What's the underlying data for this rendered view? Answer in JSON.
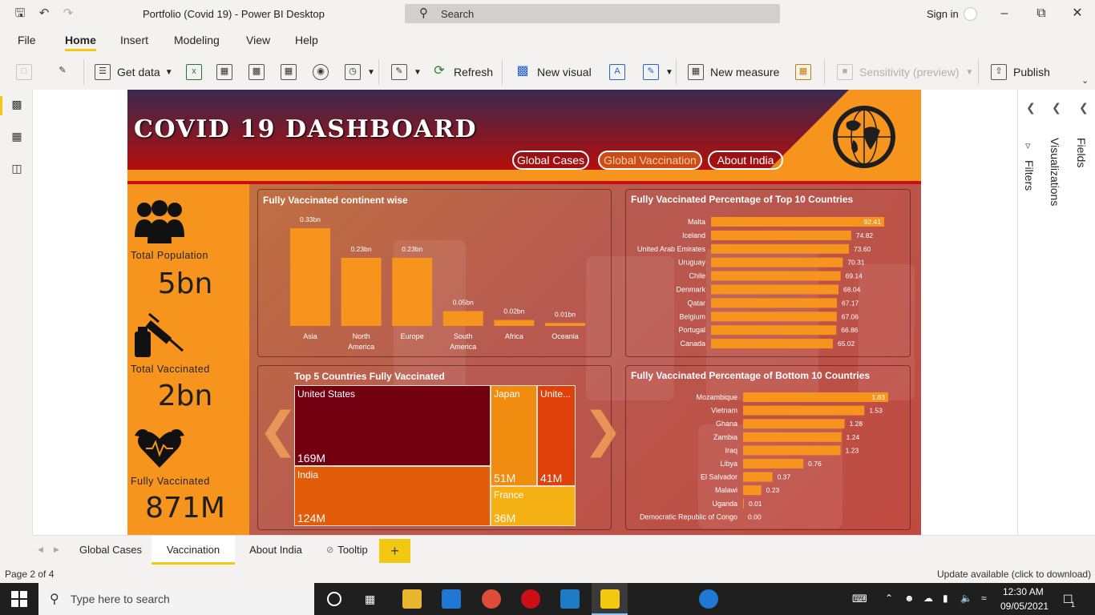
{
  "window": {
    "title": "Portfolio (Covid 19) - Power BI Desktop",
    "search_placeholder": "Search",
    "sign_in": "Sign in"
  },
  "menu": [
    "File",
    "Home",
    "Insert",
    "Modeling",
    "View",
    "Help"
  ],
  "ribbon": {
    "get_data": "Get data",
    "refresh": "Refresh",
    "new_visual": "New visual",
    "new_measure": "New measure",
    "sensitivity": "Sensitivity (preview)",
    "publish": "Publish"
  },
  "right_pane": {
    "filters": "Filters",
    "visualizations": "Visualizations",
    "fields": "Fields"
  },
  "report": {
    "title": "COVID 19 DASHBOARD",
    "nav": [
      "Global Cases",
      "Global Vaccination",
      "About India"
    ],
    "kpis": [
      {
        "label": "Total Population",
        "value": "5bn",
        "icon": "people-icon"
      },
      {
        "label": "Total Vaccinated",
        "value": "2bn",
        "icon": "syringe-icon"
      },
      {
        "label": "Fully Vaccinated",
        "value": "871M",
        "icon": "heart-muscle-icon"
      }
    ],
    "colors": {
      "accent": "#f6941e",
      "header_red": "#c81010",
      "treemap_dark": "#720010"
    }
  },
  "chart_data": [
    {
      "type": "bar",
      "title": "Fully Vaccinated continent wise",
      "categories": [
        "Asia",
        "North America",
        "Europe",
        "South America",
        "Africa",
        "Oceania"
      ],
      "category_lines": [
        [
          "Asia"
        ],
        [
          "North",
          "America"
        ],
        [
          "Europe"
        ],
        [
          "South",
          "America"
        ],
        [
          "Africa"
        ],
        [
          "Oceania"
        ]
      ],
      "values": [
        0.33,
        0.23,
        0.23,
        0.05,
        0.02,
        0.01
      ],
      "data_labels": [
        "0.33bn",
        "0.23bn",
        "0.23bn",
        "0.05bn",
        "0.02bn",
        "0.01bn"
      ],
      "ylim": [
        0,
        0.33
      ]
    },
    {
      "type": "bar",
      "orientation": "horizontal",
      "title": "Fully Vaccinated Percentage of Top 10 Countries",
      "categories": [
        "Malta",
        "Iceland",
        "United Arab Emirates",
        "Uruguay",
        "Chile",
        "Denmark",
        "Qatar",
        "Belgium",
        "Portugal",
        "Canada"
      ],
      "values": [
        92.41,
        74.82,
        73.6,
        70.31,
        69.14,
        68.04,
        67.17,
        67.06,
        66.86,
        65.02
      ],
      "data_labels": [
        "92.41",
        "74.82",
        "73.60",
        "70.31",
        "69.14",
        "68.04",
        "67.17",
        "67.06",
        "66.86",
        "65.02"
      ],
      "xlim": [
        0,
        92.41
      ]
    },
    {
      "type": "treemap",
      "title": "Top 5 Countries Fully Vaccinated",
      "items": [
        {
          "name": "United States",
          "label": "169M",
          "color": "#720010"
        },
        {
          "name": "India",
          "label": "124M",
          "color": "#e35c0a"
        },
        {
          "name": "Japan",
          "label": "51M",
          "color": "#f08c10"
        },
        {
          "name": "Unite...",
          "label": "41M",
          "color": "#e0400a"
        },
        {
          "name": "France",
          "label": "36M",
          "color": "#f5b014"
        }
      ]
    },
    {
      "type": "bar",
      "orientation": "horizontal",
      "title": "Fully Vaccinated Percentage of Bottom 10 Countries",
      "categories": [
        "Mozambique",
        "Vietnam",
        "Ghana",
        "Zambia",
        "Iraq",
        "Libya",
        "El Salvador",
        "Malawi",
        "Uganda",
        "Democratic Republic of Congo"
      ],
      "values": [
        1.83,
        1.53,
        1.28,
        1.24,
        1.23,
        0.76,
        0.37,
        0.23,
        0.01,
        0.0
      ],
      "data_labels": [
        "1.83",
        "1.53",
        "1.28",
        "1.24",
        "1.23",
        "0.76",
        "0.37",
        "0.23",
        "0.01",
        "0.00"
      ],
      "xlim": [
        0,
        1.83
      ]
    }
  ],
  "page_tabs": [
    "Global Cases",
    "Vaccination",
    "About India",
    "Tooltip"
  ],
  "status": {
    "page": "Page 2 of 4",
    "update": "Update available (click to download)"
  },
  "taskbar": {
    "search_placeholder": "Type here to search",
    "time": "12:30 AM",
    "date": "09/05/2021",
    "notifications": "1"
  }
}
